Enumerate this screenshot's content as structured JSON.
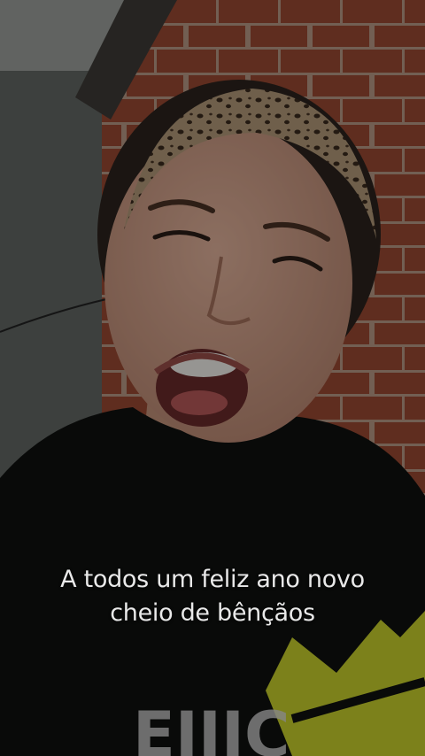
{
  "caption": {
    "line1": "A todos um feliz ano novo",
    "line2": "cheio de bênçãos"
  },
  "colors": {
    "brick": "#9a4a32",
    "mortar": "#b99a86",
    "wall": "#6c716d",
    "shirt": "#0f1110",
    "crown": "#c8d12c",
    "skin": "#d6a48c",
    "headband": "#b39a7a"
  },
  "icons": [
    "crown-print"
  ]
}
